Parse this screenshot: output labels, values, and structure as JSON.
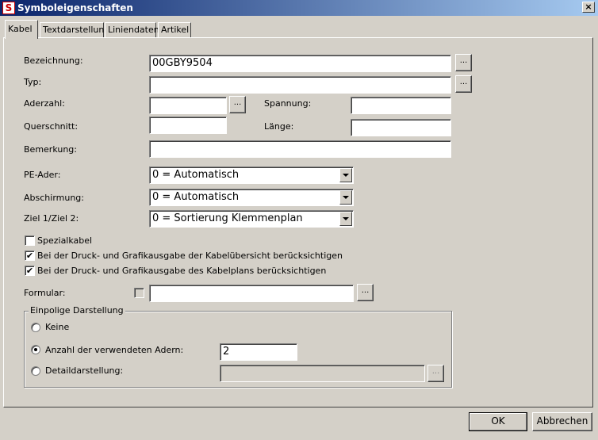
{
  "window": {
    "title": "Symboleigenschaften",
    "close": "×"
  },
  "tabs": [
    "Kabel",
    "Textdarstellung",
    "Liniendaten",
    "Artikel"
  ],
  "fields": {
    "bezeichnung": {
      "label": "Bezeichnung:",
      "value": "00GBY9504"
    },
    "typ": {
      "label": "Typ:",
      "value": ""
    },
    "aderzahl": {
      "label": "Aderzahl:",
      "value": ""
    },
    "spannung": {
      "label": "Spannung:",
      "value": ""
    },
    "querschnitt": {
      "label": "Querschnitt:",
      "value": ""
    },
    "laenge": {
      "label": "Länge:",
      "value": ""
    },
    "bemerkung": {
      "label": "Bemerkung:",
      "value": ""
    },
    "pe_ader": {
      "label": "PE-Ader:",
      "value": "0 = Automatisch"
    },
    "abschirmung": {
      "label": "Abschirmung:",
      "value": "0 = Automatisch"
    },
    "ziel": {
      "label": "Ziel 1/Ziel 2:",
      "value": "0 = Sortierung Klemmenplan"
    },
    "formular": {
      "label": "Formular:",
      "value": ""
    }
  },
  "browse_label": "...",
  "checkboxes": [
    {
      "label": "Spezialkabel",
      "checked": false
    },
    {
      "label": "Bei der Druck- und Grafikausgabe der Kabelübersicht berücksichtigen",
      "checked": true
    },
    {
      "label": "Bei der Druck- und Grafikausgabe des Kabelplans berücksichtigen",
      "checked": true
    }
  ],
  "check_mark": "✔",
  "einpolig": {
    "legend": "Einpolige Darstellung",
    "options": [
      {
        "label": "Keine",
        "selected": false
      },
      {
        "label": "Anzahl der verwendeten Adern:",
        "selected": true,
        "value": "2"
      },
      {
        "label": "Detaildarstellung:",
        "selected": false,
        "value": ""
      }
    ]
  },
  "buttons": {
    "ok": "OK",
    "cancel": "Abbrechen"
  }
}
